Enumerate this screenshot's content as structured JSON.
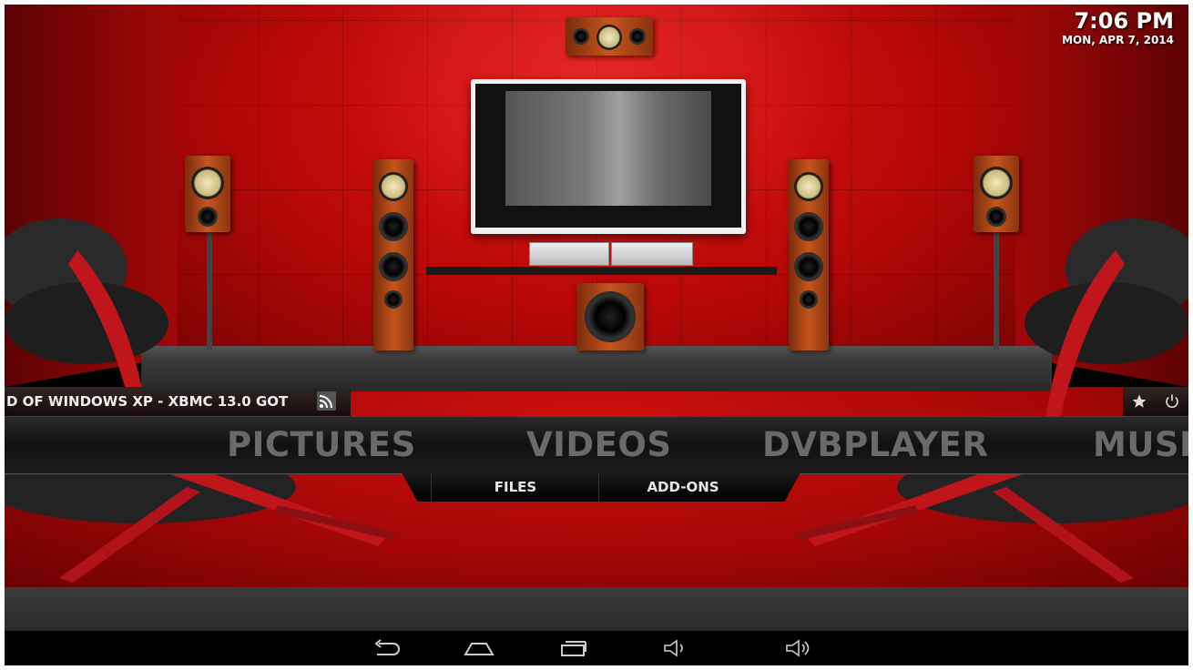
{
  "clock": {
    "time": "7:06 PM",
    "date": "MON, APR 7, 2014"
  },
  "rss": {
    "ticker_text": "D OF WINDOWS XP - XBMC 13.0 GOT",
    "icon": "rss-icon"
  },
  "top_buttons": [
    {
      "icon": "star-icon",
      "label": "Favourites"
    },
    {
      "icon": "power-icon",
      "label": "Power"
    }
  ],
  "main_menu": {
    "items": [
      "PICTURES",
      "VIDEOS",
      "DVBPLAYER",
      "MUSI"
    ]
  },
  "sub_menu": {
    "items": [
      "FILES",
      "ADD-ONS"
    ]
  },
  "nav_bar": {
    "buttons": [
      "back-icon",
      "home-icon",
      "recent-apps-icon",
      "volume-down-icon",
      "volume-up-icon"
    ]
  },
  "colors": {
    "accent_red": "#c00a0a",
    "menu_text_inactive": "#6a6a6a",
    "submenu_text": "#e6e6e6"
  }
}
